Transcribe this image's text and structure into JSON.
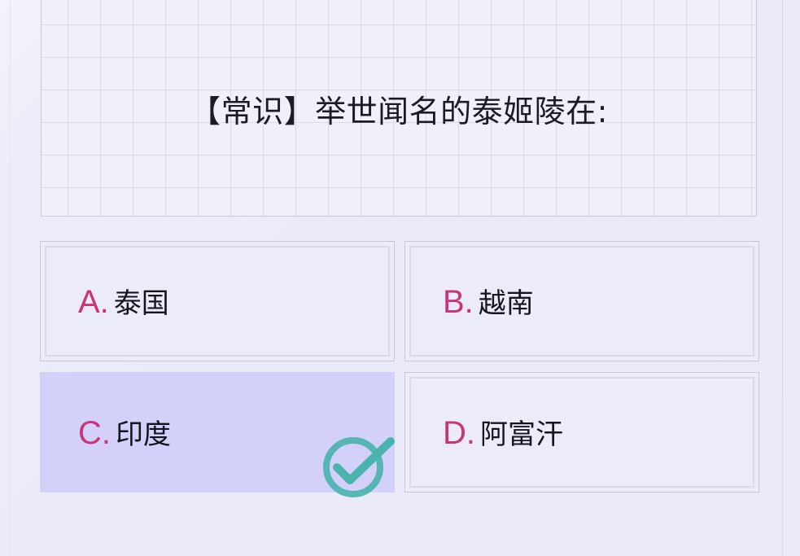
{
  "question": {
    "text": "【常识】举世闻名的泰姬陵在:"
  },
  "options": [
    {
      "letter": "A.",
      "text": "泰国",
      "selected": false
    },
    {
      "letter": "B.",
      "text": "越南",
      "selected": false
    },
    {
      "letter": "C.",
      "text": "印度",
      "selected": true
    },
    {
      "letter": "D.",
      "text": "阿富汗",
      "selected": false
    }
  ],
  "result": {
    "icon": "checkmark-icon",
    "state": "correct"
  },
  "colors": {
    "letter": "#c8357a",
    "selected_bg": "#d3d1fa",
    "check": "#4bb3ad"
  }
}
